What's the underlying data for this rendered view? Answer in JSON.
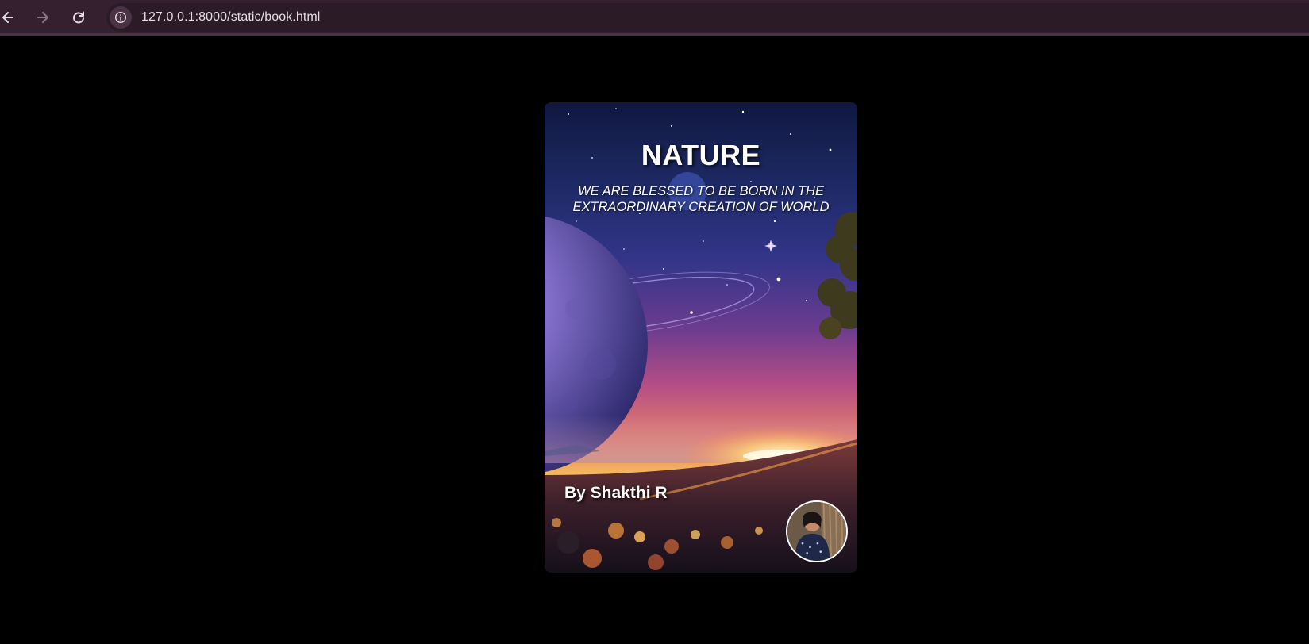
{
  "browser": {
    "url": "127.0.0.1:8000/static/book.html",
    "icons": {
      "back": "arrow-left-icon",
      "forward": "arrow-right-icon",
      "reload": "reload-icon",
      "site_info": "info-icon"
    }
  },
  "book": {
    "title": "NATURE",
    "subtitle": "WE ARE BLESSED TO BE BORN IN THE EXTRAORDINARY CREATION OF WORLD",
    "author": "By Shakthi R"
  },
  "colors": {
    "page_background": "#000000",
    "toolbar": "#35202f",
    "address_bar": "#2a1b26",
    "text": "#ffffff"
  }
}
